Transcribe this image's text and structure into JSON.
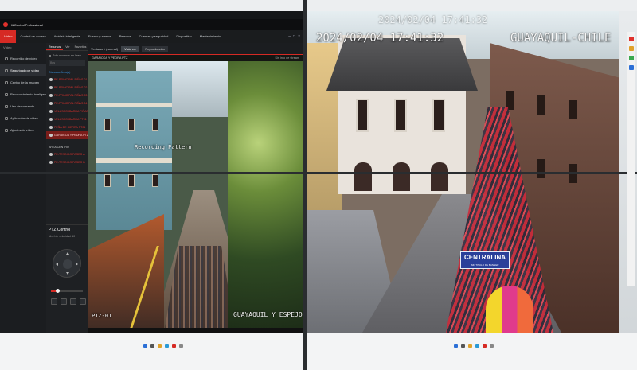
{
  "vms": {
    "app_name": "HikCentral Professional",
    "menu": [
      "Vídeo",
      "Control de acceso",
      "Análisis inteligente",
      "Evento y alarma",
      "Persona",
      "Cuentas y seguridad",
      "Dispositivo",
      "Mantenimiento"
    ],
    "active_menu_index": 0,
    "nav_header": "Vídeo",
    "nav_items": [
      "Recorrido de vídeo",
      "Seguridad por vídeo",
      "Centro de la imagen",
      "Reconocimiento inteligente",
      "Uso de comando",
      "Aplicación de vídeo",
      "Ajustes de vídeo"
    ],
    "active_nav_index": 1,
    "resource_tabs": [
      "Recursos",
      "Ver",
      "Favoritos"
    ],
    "show_only_online": "Solo recursos en línea",
    "search_placeholder": "Bus",
    "group_label": "Cámaras",
    "group_count": "Área(s)",
    "cameras": [
      "PE-PRINCIPAL PIÑAS 01",
      "PE-PRINCIPAL PIÑAS 02",
      "PE-PRINCIPAL PIÑAS 03",
      "PE-PRINCIPAL PIÑAS 04",
      "VELASCO IBARRA PIÑAS",
      "VELASCO IBARRA PT01",
      "PEÑA DE SIERRA PT01",
      "GARAICOA Y PEDRA PTZ"
    ],
    "selected_camera_index": 7,
    "group2_label": "AREA CENTRO",
    "group2_cameras": [
      "PE-TENDIDO PASEO A",
      "PE-TENDIDO PASEO B"
    ],
    "ptz": {
      "title": "PTZ Control",
      "speed_label": "Nivel de velocidad: 10",
      "speed": 0.2
    },
    "toolbar": {
      "view_name": "Ventana 1 (normal)",
      "live_label": "Vista en",
      "playback_label": "Reproducción"
    },
    "tile": {
      "camera_name": "GARAICOA Y PEDRA PTZ",
      "right_status": "Sin info de stream",
      "osd_pattern": "Recording Pattern",
      "osd_name": "GUAYAQUIL Y ESPEJO",
      "osd_ptz": "PTZ-01"
    }
  },
  "camera_feed": {
    "date": "2024/02/04 17:41:32",
    "location": "GUAYAQUIL-CHILE",
    "banner_text": "CENTRALINA",
    "banner_subtext": "SIN TITULO DE BANNER"
  },
  "colors": {
    "accent": "#d62a24",
    "panel_bg": "#141618",
    "camera_text": "#e0312c"
  }
}
